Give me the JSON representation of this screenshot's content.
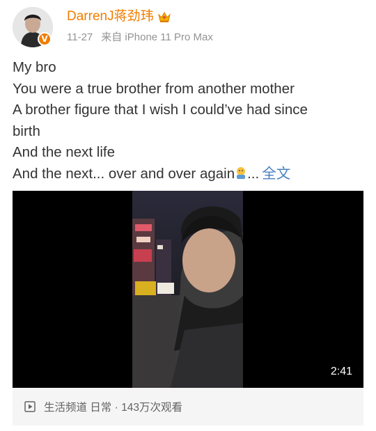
{
  "post": {
    "username": "DarrenJ蒋劲玮",
    "date": "11-27",
    "source": "来自 iPhone 11 Pro Max",
    "lines": [
      "My bro",
      "You were a true brother from another mother",
      "A brother figure that I wish I could’ve had since",
      "birth",
      "And the next life",
      "And the next...  over and over again"
    ],
    "ellipsis": "...",
    "full_text_link": "全文"
  },
  "video": {
    "duration": "2:41",
    "footer_text": "生活频道 日常 · 143万次观看"
  },
  "icons": {
    "verified_badge": "verified-v-icon",
    "crown": "crown-icon",
    "emoji": "hugging-emoji-icon",
    "play": "video-play-icon"
  },
  "colors": {
    "username": "#f07d00",
    "link": "#4a82c2",
    "meta": "#939393"
  }
}
